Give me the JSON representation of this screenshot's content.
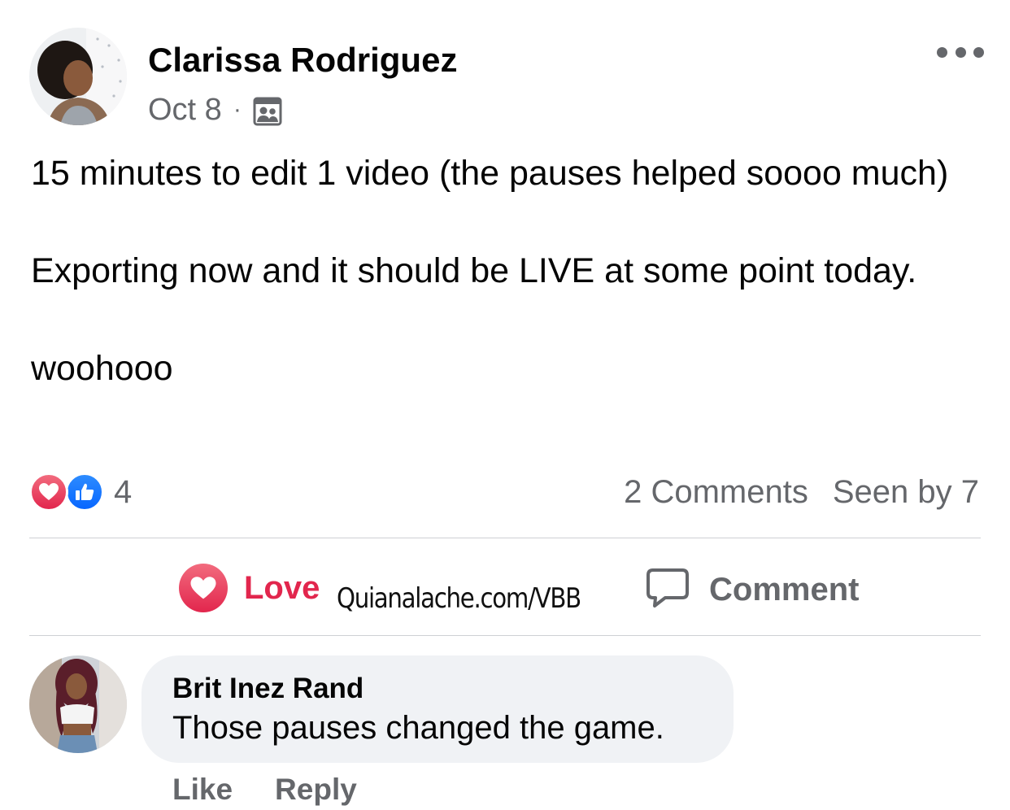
{
  "post": {
    "author": "Clarissa Rodriguez",
    "date": "Oct 8",
    "separator": "·",
    "audience_icon": "group-icon",
    "more_icon": "more-options-icon",
    "body": {
      "line1": "15 minutes to edit 1 video (the pauses helped soooo much)",
      "line2": "Exporting now and it should be LIVE at some point today.",
      "line3": "woohooo"
    }
  },
  "reactions": {
    "icons": [
      "love-reaction-icon",
      "like-reaction-icon"
    ],
    "count": "4",
    "comments": "2 Comments",
    "seen_by": "Seen by 7"
  },
  "actions": {
    "love_label": "Love",
    "comment_label": "Comment"
  },
  "watermark": "Quianalache.com/VBB",
  "comment": {
    "author": "Brit Inez Rand",
    "text": "Those pauses changed the game.",
    "like_label": "Like",
    "reply_label": "Reply"
  },
  "colors": {
    "love": "#e2264d",
    "like": "#0866ff",
    "secondary_text": "#65676b",
    "bubble": "#f0f2f5"
  }
}
